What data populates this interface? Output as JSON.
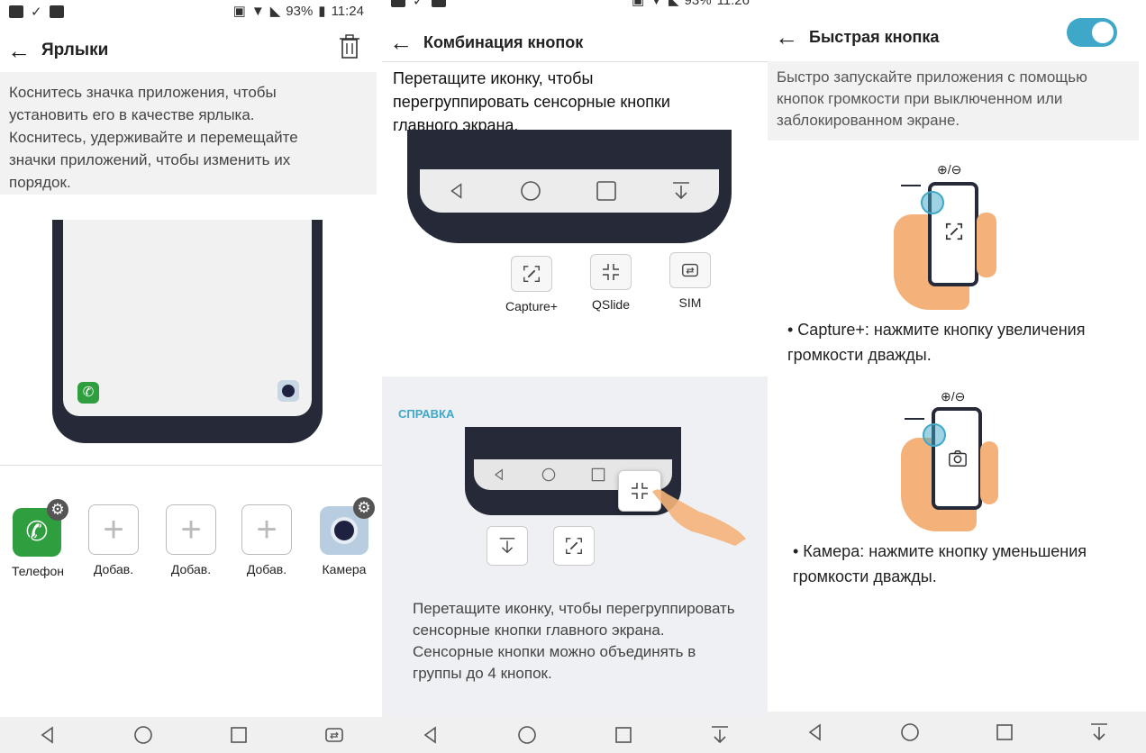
{
  "status": {
    "battery": "93%",
    "time1": "11:24",
    "time2": "11:26"
  },
  "panel1": {
    "title": "Ярлыки",
    "description": "Коснитесь значка приложения, чтобы установить его в качестве ярлыка. Коснитесь, удерживайте и перемещайте значки приложений, чтобы изменить их порядок.",
    "apps": [
      {
        "label": "Телефон"
      },
      {
        "label": "Добав."
      },
      {
        "label": "Добав."
      },
      {
        "label": "Добав."
      },
      {
        "label": "Камера"
      }
    ]
  },
  "panel2": {
    "title": "Комбинация кнопок",
    "instruction": "Перетащите иконку, чтобы перегруппировать сенсорные кнопки главного экрана.",
    "buttons": [
      {
        "label": "Capture+",
        "icon": "capture-plus-icon"
      },
      {
        "label": "QSlide",
        "icon": "qslide-icon"
      },
      {
        "label": "SIM",
        "icon": "sim-switch-icon"
      }
    ],
    "help_heading": "СПРАВКА",
    "help_text": "Перетащите иконку, чтобы перегруппировать сенсорные кнопки главного экрана. Сенсорные кнопки можно объединять в группы до 4 кнопок."
  },
  "panel3": {
    "title": "Быстрая кнопка",
    "toggle_on": true,
    "description": "Быстро запускайте приложения с помощью кнопок громкости при выключенном или заблокированном экране.",
    "volume_label": "⊕/⊖",
    "bullet1": "• Capture+: нажмите кнопку увеличения громкости дважды.",
    "bullet2": "• Камера: нажмите кнопку уменьшения громкости дважды."
  },
  "colors": {
    "accent": "#3fa8c8",
    "frame": "#262a38",
    "skin": "#f4b27a",
    "phone_green": "#2e9e3e"
  }
}
